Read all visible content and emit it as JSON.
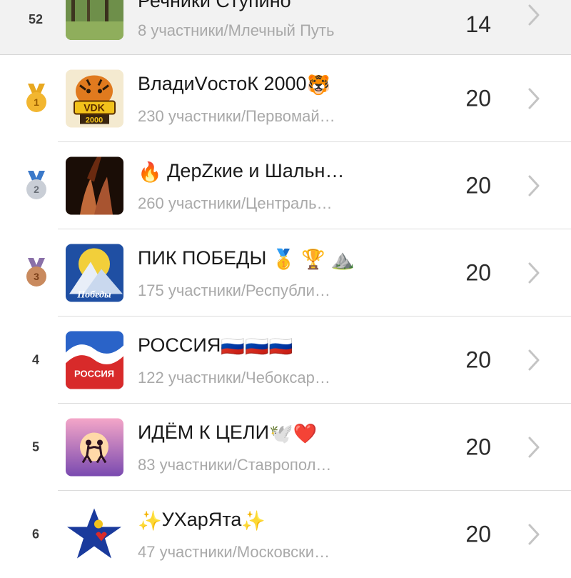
{
  "colors": {
    "background": "#ffffff",
    "highlight_row": "#f2f2f2",
    "separator": "#dcdcdc",
    "subtitle": "#a9a9a9",
    "chevron": "#c4c4c4",
    "gold": "#f2b630",
    "silver": "#c9ced6",
    "bronze": "#c98a5e"
  },
  "rows": [
    {
      "rank": "52",
      "title": "Речники Ступино",
      "subtitle": "8 участники/Млечный Путь",
      "score": "14",
      "medal": "",
      "thumb_icon": "forest-photo-icon"
    },
    {
      "rank": "1",
      "title": "ВладиVостоК 2000",
      "title_emoji": "🐯",
      "subtitle": "230 участники/Первомай…",
      "score": "20",
      "medal": "gold-medal-icon",
      "thumb_icon": "tiger-vdk-logo-icon"
    },
    {
      "rank": "2",
      "title": "ДерZкие и Шальн…",
      "title_emoji": "🔥",
      "subtitle": "260 участники/Централь…",
      "score": "20",
      "medal": "silver-medal-icon",
      "thumb_icon": "fire-hands-photo-icon"
    },
    {
      "rank": "3",
      "title": "ПИК ПОБЕДЫ",
      "title_emoji": "🥇 🏆 ⛰️",
      "subtitle": "175 участники/Республи…",
      "score": "20",
      "medal": "bronze-medal-icon",
      "thumb_icon": "pik-pobedy-logo-icon"
    },
    {
      "rank": "4",
      "title": "РОССИЯ",
      "title_emoji": "🇷🇺🇷🇺🇷🇺",
      "subtitle": "122 участники/Чебоксар…",
      "score": "20",
      "medal": "",
      "thumb_icon": "russia-logo-icon"
    },
    {
      "rank": "5",
      "title": "ИДЁМ К ЦЕЛИ",
      "title_emoji": "🕊️❤️",
      "subtitle": "83 участники/Ставропол…",
      "score": "20",
      "medal": "",
      "thumb_icon": "couple-sunset-logo-icon"
    },
    {
      "rank": "6",
      "title": "УХарЯта",
      "title_prefix_emoji": "✨",
      "title_emoji": "✨",
      "subtitle": "47 участники/Московски…",
      "score": "20",
      "medal": "",
      "thumb_icon": "blue-star-logo-icon"
    }
  ]
}
